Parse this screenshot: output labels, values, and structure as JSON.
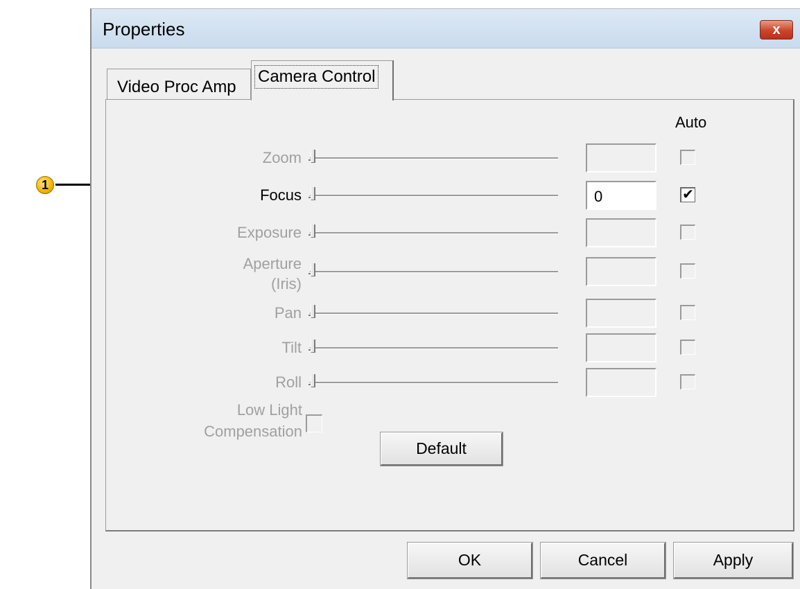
{
  "callout": {
    "number": "1"
  },
  "window": {
    "title": "Properties",
    "close_symbol": "x"
  },
  "tabs": [
    {
      "label": "Video Proc Amp",
      "active": false
    },
    {
      "label": "Camera Control",
      "active": true
    }
  ],
  "panel": {
    "auto_header": "Auto",
    "controls": [
      {
        "label": "Zoom",
        "value": "",
        "auto_checked": false,
        "enabled": false
      },
      {
        "label": "Focus",
        "value": "0",
        "auto_checked": true,
        "enabled": true
      },
      {
        "label": "Exposure",
        "value": "",
        "auto_checked": false,
        "enabled": false
      },
      {
        "label": "Aperture (Iris)",
        "label_line1": "Aperture",
        "label_line2": "(Iris)",
        "value": "",
        "auto_checked": false,
        "enabled": false
      },
      {
        "label": "Pan",
        "value": "",
        "auto_checked": false,
        "enabled": false
      },
      {
        "label": "Tilt",
        "value": "",
        "auto_checked": false,
        "enabled": false
      },
      {
        "label": "Roll",
        "value": "",
        "auto_checked": false,
        "enabled": false
      }
    ],
    "low_light": {
      "line1": "Low Light",
      "line2": "Compensation",
      "checked": false
    },
    "default_button": "Default"
  },
  "buttons": {
    "ok": "OK",
    "cancel": "Cancel",
    "apply": "Apply"
  },
  "colors": {
    "disabled_text": "#a0a0a0",
    "dialog_bg": "#f0f0f0",
    "close_red": "#c9452b",
    "callout_yellow": "#f0b400"
  }
}
